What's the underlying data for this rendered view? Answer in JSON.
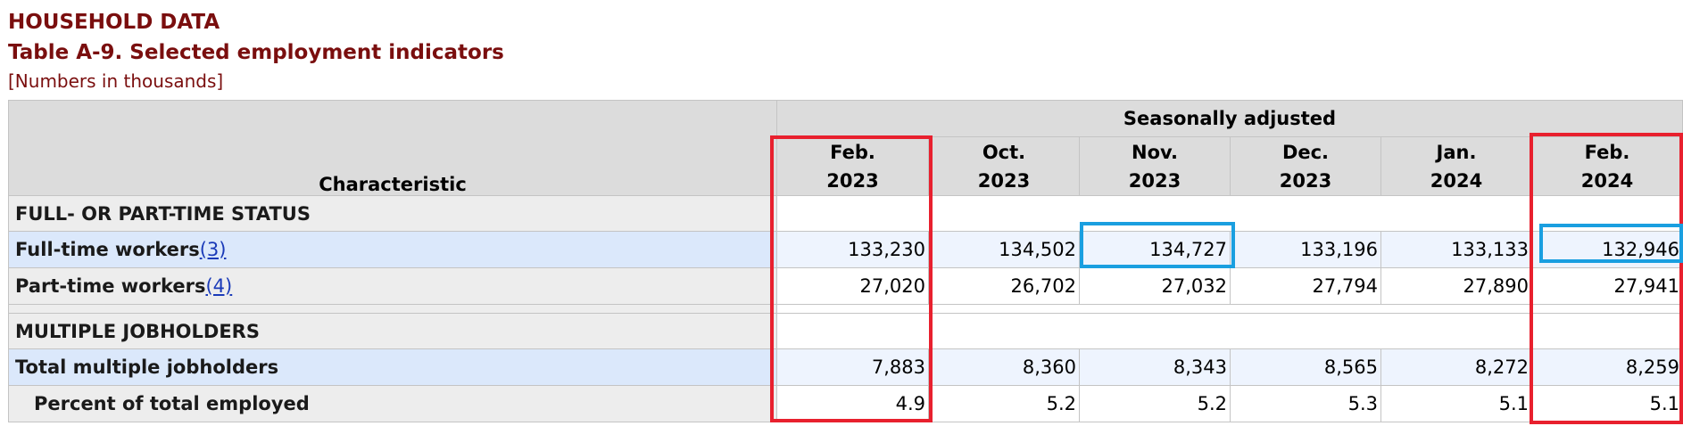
{
  "header": {
    "supertitle": "HOUSEHOLD DATA",
    "title": "Table A-9. Selected employment indicators",
    "note": "[Numbers in thousands]"
  },
  "table": {
    "characteristic_label": "Characteristic",
    "group_label": "Seasonally adjusted",
    "columns": [
      {
        "month": "Feb.",
        "year": "2023"
      },
      {
        "month": "Oct.",
        "year": "2023"
      },
      {
        "month": "Nov.",
        "year": "2023"
      },
      {
        "month": "Dec.",
        "year": "2023"
      },
      {
        "month": "Jan.",
        "year": "2024"
      },
      {
        "month": "Feb.",
        "year": "2024"
      }
    ],
    "sections": [
      {
        "title": "FULL- OR PART-TIME STATUS",
        "rows": [
          {
            "label": "Full-time workers",
            "footnote": "(3)",
            "footnote_num": "3",
            "values": [
              "133,230",
              "134,502",
              "134,727",
              "133,196",
              "133,133",
              "132,946"
            ]
          },
          {
            "label": "Part-time workers",
            "footnote": "(4)",
            "footnote_num": "4",
            "values": [
              "27,020",
              "26,702",
              "27,032",
              "27,794",
              "27,890",
              "27,941"
            ]
          }
        ]
      },
      {
        "title": "MULTIPLE JOBHOLDERS",
        "rows": [
          {
            "label": "Total multiple jobholders",
            "values": [
              "7,883",
              "8,360",
              "8,343",
              "8,565",
              "8,272",
              "8,259"
            ]
          },
          {
            "label": "Percent of total employed",
            "values": [
              "4.9",
              "5.2",
              "5.2",
              "5.3",
              "5.1",
              "5.1"
            ]
          }
        ]
      }
    ]
  },
  "highlights": {
    "red_color": "#e8202e",
    "blue_color": "#1a9fe0"
  }
}
